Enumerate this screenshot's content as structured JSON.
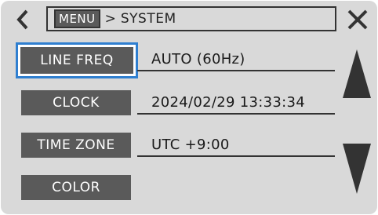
{
  "header": {
    "menu_label": "MENU",
    "separator": ">",
    "current_page": "SYSTEM",
    "back_icon": "chevron-left-icon",
    "close_icon": "close-icon"
  },
  "settings": [
    {
      "label": "LINE FREQ",
      "value": "AUTO (60Hz)",
      "selected": true
    },
    {
      "label": "CLOCK",
      "value": "2024/02/29 13:33:34",
      "selected": false
    },
    {
      "label": "TIME ZONE",
      "value": "UTC +9:00",
      "selected": false
    },
    {
      "label": "COLOR",
      "value": "",
      "selected": false
    }
  ],
  "scroll": {
    "up_icon": "triangle-up-icon",
    "down_icon": "triangle-down-icon"
  },
  "colors": {
    "background": "#d9d9d9",
    "button": "#5a5a5a",
    "selection": "#2f7fd0"
  }
}
